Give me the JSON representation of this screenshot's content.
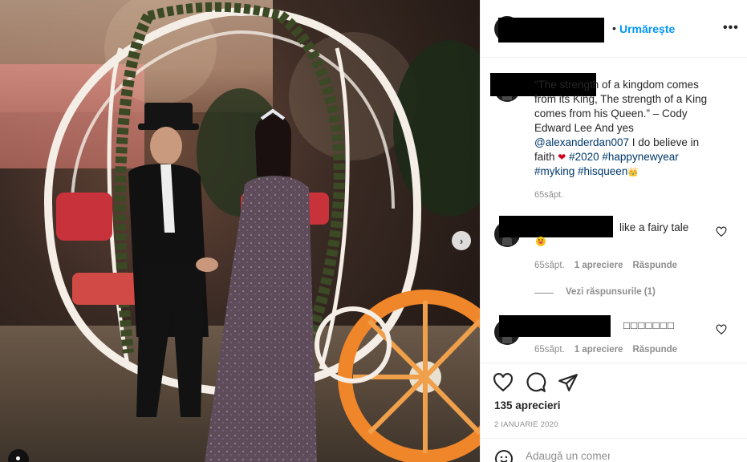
{
  "header": {
    "separator": "•",
    "follow_label": "Urmărește",
    "more_label": "•••"
  },
  "caption": {
    "text": "“The strength of a kingdom comes from its King, The strength of a King comes from his Queen.” – Cody Edward Lee And yes ",
    "mention": "@alexanderdan007",
    "text2": " I do believe in faith ",
    "heart": "❤",
    "tags": "#2020 #happynewyear #myking #hisqueen",
    "crown": "👑",
    "time": "65săpt."
  },
  "comments": [
    {
      "text": "like a fairy tale",
      "time": "65săpt.",
      "likes": "1 apreciere",
      "reply": "Răspunde",
      "view_replies": "Vezi răspunsurile (1)"
    },
    {
      "text": "□□□□□□□",
      "time": "65săpt.",
      "likes": "1 apreciere",
      "reply": "Răspunde"
    }
  ],
  "photo": {
    "next_label": "›"
  },
  "actions": {
    "likes_count": "135 aprecieri",
    "date": "2 IANUARIE 2020"
  },
  "add_comment": {
    "placeholder": "Adaugă un comentariu..."
  },
  "icons": {
    "like": "heart-outline-icon",
    "comment": "speech-bubble-icon",
    "share": "paper-plane-icon",
    "emoji": "smiley-icon"
  },
  "colors": {
    "link": "#0095f6",
    "tag": "#00376b",
    "muted": "#8e8e8e"
  }
}
